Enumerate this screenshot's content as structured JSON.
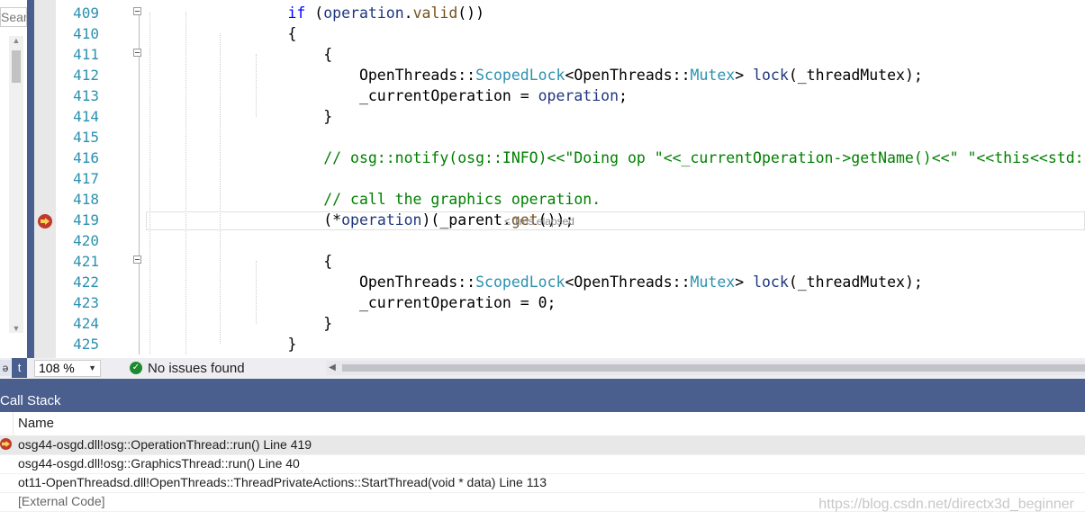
{
  "left_panel": {
    "search_text": "Sear"
  },
  "editor": {
    "lines": [
      {
        "n": "409",
        "tokens": [
          [
            "",
            "        "
          ],
          [
            "kw",
            "if"
          ],
          [
            "",
            " ("
          ],
          [
            "var",
            "operation"
          ],
          [
            "",
            "."
          ],
          [
            "fn",
            "valid"
          ],
          [
            "",
            "())"
          ]
        ],
        "fold": true
      },
      {
        "n": "410",
        "tokens": [
          [
            "",
            "        {"
          ]
        ],
        "fold": false
      },
      {
        "n": "411",
        "tokens": [
          [
            "",
            "            {"
          ]
        ],
        "fold": true
      },
      {
        "n": "412",
        "tokens": [
          [
            "",
            "                OpenThreads::"
          ],
          [
            "cls",
            "ScopedLock"
          ],
          [
            "",
            "<OpenThreads::"
          ],
          [
            "cls",
            "Mutex"
          ],
          [
            "",
            "> "
          ],
          [
            "var",
            "lock"
          ],
          [
            "",
            "(_threadMutex);"
          ]
        ],
        "fold": false
      },
      {
        "n": "413",
        "tokens": [
          [
            "",
            "                _currentOperation = "
          ],
          [
            "var",
            "operation"
          ],
          [
            "",
            ";"
          ]
        ],
        "fold": false
      },
      {
        "n": "414",
        "tokens": [
          [
            "",
            "            }"
          ]
        ],
        "fold": false
      },
      {
        "n": "415",
        "tokens": [
          [
            "",
            ""
          ]
        ],
        "fold": false
      },
      {
        "n": "416",
        "tokens": [
          [
            "cm",
            "            // osg::notify(osg::INFO)<<\"Doing op \"<<_currentOperation->getName()<<\" \"<<this<<std::endl;"
          ]
        ],
        "fold": false
      },
      {
        "n": "417",
        "tokens": [
          [
            "",
            ""
          ]
        ],
        "fold": false
      },
      {
        "n": "418",
        "tokens": [
          [
            "cm",
            "            // call the graphics operation."
          ]
        ],
        "fold": false
      },
      {
        "n": "419",
        "tokens": [
          [
            "",
            "            (*"
          ],
          [
            "var",
            "operation"
          ],
          [
            "",
            ")(_parent."
          ],
          [
            "fn",
            "get"
          ],
          [
            "",
            "());"
          ]
        ],
        "fold": false
      },
      {
        "n": "420",
        "tokens": [
          [
            "",
            ""
          ]
        ],
        "fold": false
      },
      {
        "n": "421",
        "tokens": [
          [
            "",
            "            {"
          ]
        ],
        "fold": true
      },
      {
        "n": "422",
        "tokens": [
          [
            "",
            "                OpenThreads::"
          ],
          [
            "cls",
            "ScopedLock"
          ],
          [
            "",
            "<OpenThreads::"
          ],
          [
            "cls",
            "Mutex"
          ],
          [
            "",
            "> "
          ],
          [
            "var",
            "lock"
          ],
          [
            "",
            "(_threadMutex);"
          ]
        ],
        "fold": false
      },
      {
        "n": "423",
        "tokens": [
          [
            "",
            "                _currentOperation = 0;"
          ]
        ],
        "fold": false
      },
      {
        "n": "424",
        "tokens": [
          [
            "",
            "            }"
          ]
        ],
        "fold": false
      },
      {
        "n": "425",
        "tokens": [
          [
            "",
            "        }"
          ]
        ],
        "fold": false
      }
    ],
    "current_line": "419",
    "elapsed_hint": "≤ 1ms elapsed"
  },
  "status": {
    "zoom": "108 %",
    "issues": "No issues found"
  },
  "call_stack": {
    "title": "Call Stack",
    "column_name": "Name",
    "rows": [
      {
        "text": "osg44-osgd.dll!osg::OperationThread::run() Line 419",
        "current": true,
        "external": false
      },
      {
        "text": "osg44-osgd.dll!osg::GraphicsThread::run() Line 40",
        "current": false,
        "external": false
      },
      {
        "text": "ot11-OpenThreadsd.dll!OpenThreads::ThreadPrivateActions::StartThread(void * data) Line 113",
        "current": false,
        "external": false
      },
      {
        "text": "[External Code]",
        "current": false,
        "external": true
      }
    ],
    "watermark": "https://blog.csdn.net/directx3d_beginner"
  },
  "colors": {
    "keyword": "#0000ff",
    "class": "#2b91af",
    "function": "#74531f",
    "comment": "#008000",
    "variable": "#1f377f",
    "accent": "#4a5f8e",
    "breakpoint": "#c0392b"
  },
  "icons": [
    "current-statement-arrow-icon",
    "fold-icon",
    "success-check-icon",
    "dropdown-caret-icon",
    "scroll-left-icon"
  ]
}
